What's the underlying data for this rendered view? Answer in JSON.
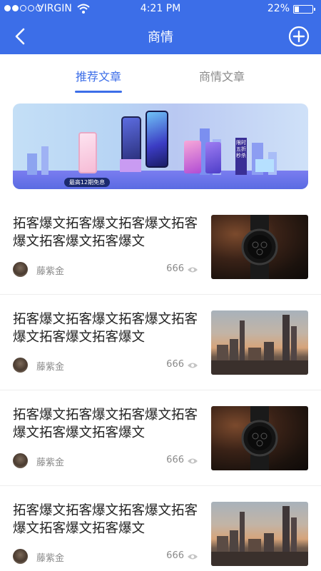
{
  "status_bar": {
    "carrier": "VIRGIN",
    "time": "4:21 PM",
    "battery": "22%",
    "battery_level": 0.22,
    "signal_bars": 2,
    "signal_total": 5
  },
  "nav": {
    "title": "商情",
    "back_icon": "chevron-left-icon",
    "add_icon": "plus-circle-icon"
  },
  "tabs": [
    {
      "label": "推荐文章",
      "active": true
    },
    {
      "label": "商情文章",
      "active": false
    }
  ],
  "banner": {
    "tag": "最高12期免息",
    "sale_text": "限时五折秒杀"
  },
  "articles": [
    {
      "title": "拓客爆文拓客爆文拓客爆文拓客爆文拓客爆文拓客爆文",
      "author": "藤紫金",
      "views": "666",
      "thumb": "watch"
    },
    {
      "title": "拓客爆文拓客爆文拓客爆文拓客爆文拓客爆文拓客爆文",
      "author": "藤紫金",
      "views": "666",
      "thumb": "city"
    },
    {
      "title": "拓客爆文拓客爆文拓客爆文拓客爆文拓客爆文拓客爆文",
      "author": "藤紫金",
      "views": "666",
      "thumb": "watch"
    },
    {
      "title": "拓客爆文拓客爆文拓客爆文拓客爆文拓客爆文拓客爆文",
      "author": "藤紫金",
      "views": "666",
      "thumb": "city"
    }
  ],
  "colors": {
    "primary": "#3c6ee8",
    "muted": "#8a8a8a",
    "text": "#222222"
  }
}
